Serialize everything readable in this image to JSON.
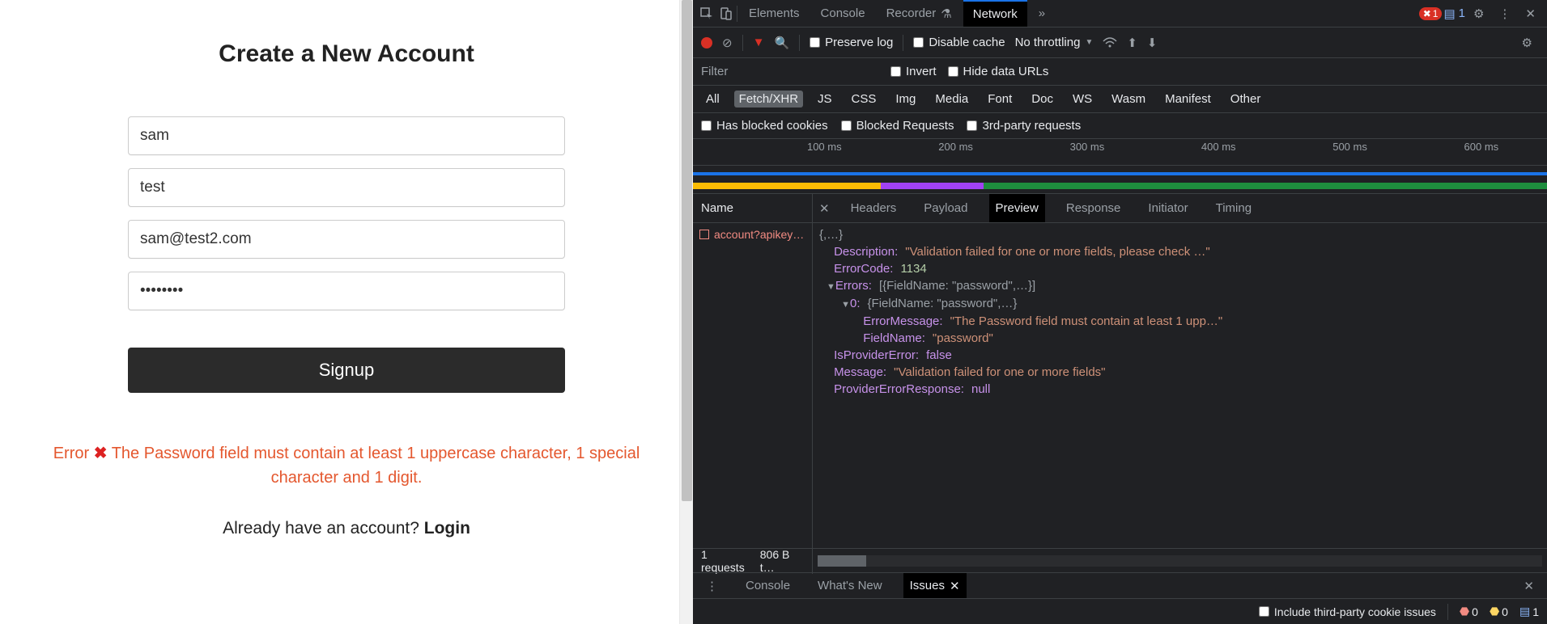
{
  "page": {
    "title": "Create a New Account",
    "fields": {
      "first": "sam",
      "last": "test",
      "email": "sam@test2.com",
      "password": "••••••••"
    },
    "signup_label": "Signup",
    "error_label": "Error",
    "error_text": "The Password field must contain at least 1 uppercase character, 1 special character and 1 digit.",
    "login_prompt": "Already have an account? ",
    "login_link": "Login"
  },
  "devtools": {
    "tabs": {
      "elements": "Elements",
      "console": "Console",
      "recorder": "Recorder",
      "network": "Network",
      "more": "»"
    },
    "badges": {
      "errors": "1",
      "messages": "1"
    },
    "toolbar": {
      "preserve_log": "Preserve log",
      "disable_cache": "Disable cache",
      "throttling": "No throttling"
    },
    "filter_placeholder": "Filter",
    "invert": "Invert",
    "hide_data_urls": "Hide data URLs",
    "filter_types": [
      "All",
      "Fetch/XHR",
      "JS",
      "CSS",
      "Img",
      "Media",
      "Font",
      "Doc",
      "WS",
      "Wasm",
      "Manifest",
      "Other"
    ],
    "filter_type_active": "Fetch/XHR",
    "row4": {
      "blocked_cookies": "Has blocked cookies",
      "blocked_requests": "Blocked Requests",
      "third_party": "3rd-party requests"
    },
    "timeline_ticks": [
      "100 ms",
      "200 ms",
      "300 ms",
      "400 ms",
      "500 ms",
      "600 ms"
    ],
    "request_list": {
      "header": "Name",
      "item": "account?apikey…"
    },
    "detail_tabs": [
      "Headers",
      "Payload",
      "Preview",
      "Response",
      "Initiator",
      "Timing"
    ],
    "detail_tab_active": "Preview",
    "preview": {
      "root": "{,…}",
      "desc_key": "Description:",
      "desc_val": "\"Validation failed for one or more fields, please check …\"",
      "code_key": "ErrorCode:",
      "code_val": "1134",
      "errors_key": "Errors:",
      "errors_summary": "[{FieldName: \"password\",…}]",
      "idx_key": "0:",
      "idx_summary": "{FieldName: \"password\",…}",
      "errmsg_key": "ErrorMessage:",
      "errmsg_val": "\"The Password field must contain at least 1 upp…\"",
      "fieldname_key": "FieldName:",
      "fieldname_val": "\"password\"",
      "isprov_key": "IsProviderError:",
      "isprov_val": "false",
      "msg_key": "Message:",
      "msg_val": "\"Validation failed for one or more fields\"",
      "provresp_key": "ProviderErrorResponse:",
      "provresp_val": "null"
    },
    "status": {
      "requests": "1 requests",
      "transferred": "806 B t…"
    },
    "drawer": {
      "console": "Console",
      "whatsnew": "What's New",
      "issues": "Issues"
    },
    "bottom": {
      "include_cookies": "Include third-party cookie issues",
      "err_count": "0",
      "warn_count": "0",
      "msg_count": "1"
    }
  }
}
